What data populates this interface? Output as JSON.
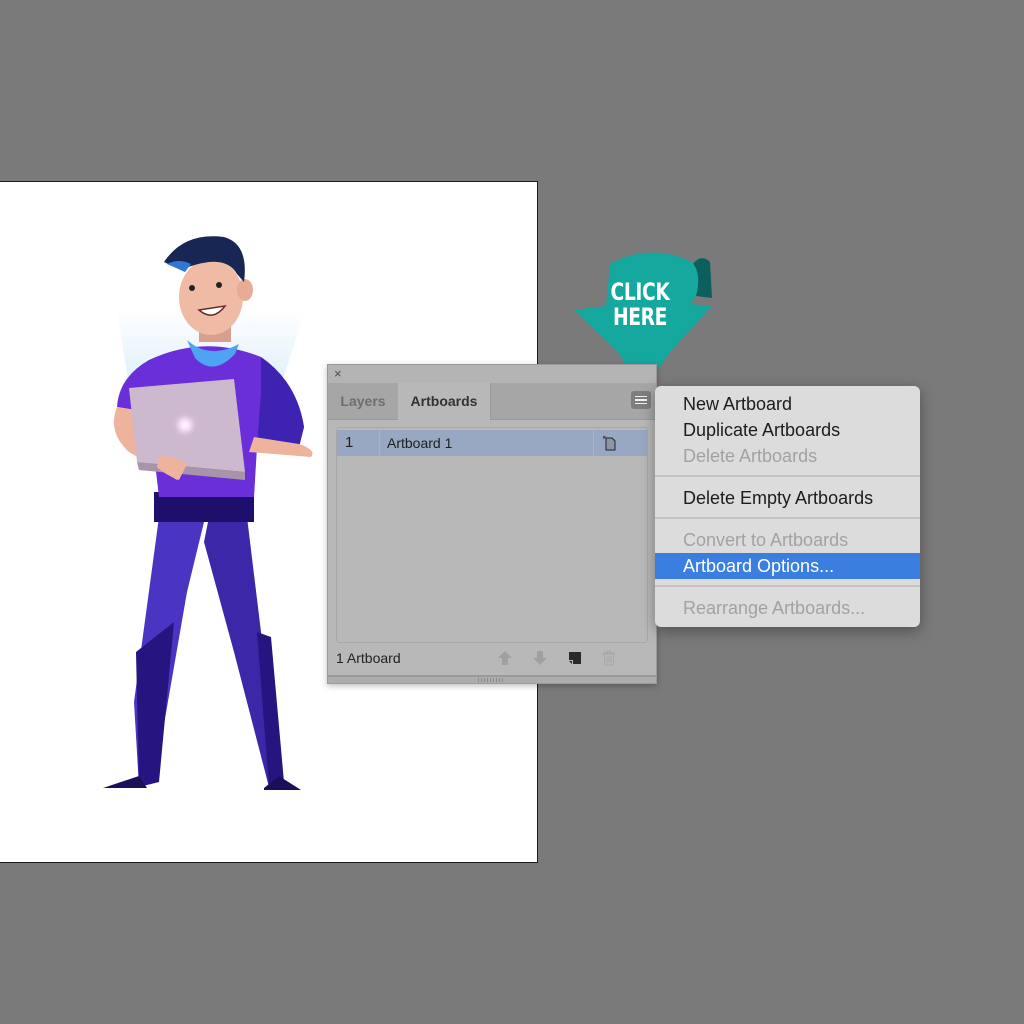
{
  "canvas": {
    "background_color": "#7a7a7a",
    "artboard_color": "#ffffff"
  },
  "callout": {
    "text_line1": "CLICK",
    "text_line2": "HERE",
    "color": "#14a89e",
    "icon": "arrow-down-callout"
  },
  "panel": {
    "close_label": "×",
    "tabs": [
      {
        "label": "Layers",
        "active": false
      },
      {
        "label": "Artboards",
        "active": true
      }
    ],
    "menu_icon": "hamburger-menu-icon",
    "rows": [
      {
        "number": "1",
        "name": "Artboard 1",
        "icon": "artboard-page-icon",
        "selected": true
      }
    ],
    "footer": {
      "count_label": "1 Artboard",
      "buttons": [
        {
          "name": "move-up",
          "icon": "arrow-up-icon",
          "enabled": false
        },
        {
          "name": "move-down",
          "icon": "arrow-down-icon",
          "enabled": false
        },
        {
          "name": "new-artboard",
          "icon": "new-artboard-icon",
          "enabled": true
        },
        {
          "name": "delete",
          "icon": "trash-icon",
          "enabled": false
        }
      ]
    },
    "selection_color": "#98a8c2"
  },
  "dropdown": {
    "items": [
      {
        "label": "New Artboard",
        "disabled": false,
        "selected": false
      },
      {
        "label": "Duplicate Artboards",
        "disabled": false,
        "selected": false
      },
      {
        "label": "Delete Artboards",
        "disabled": true,
        "selected": false
      },
      {
        "label": "Delete Empty Artboards",
        "disabled": false,
        "selected": false
      },
      {
        "label": "Convert to Artboards",
        "disabled": true,
        "selected": false
      },
      {
        "label": "Artboard Options...",
        "disabled": false,
        "selected": true
      },
      {
        "label": "Rearrange Artboards...",
        "disabled": true,
        "selected": false
      }
    ],
    "highlight_color": "#3a7ee0"
  }
}
